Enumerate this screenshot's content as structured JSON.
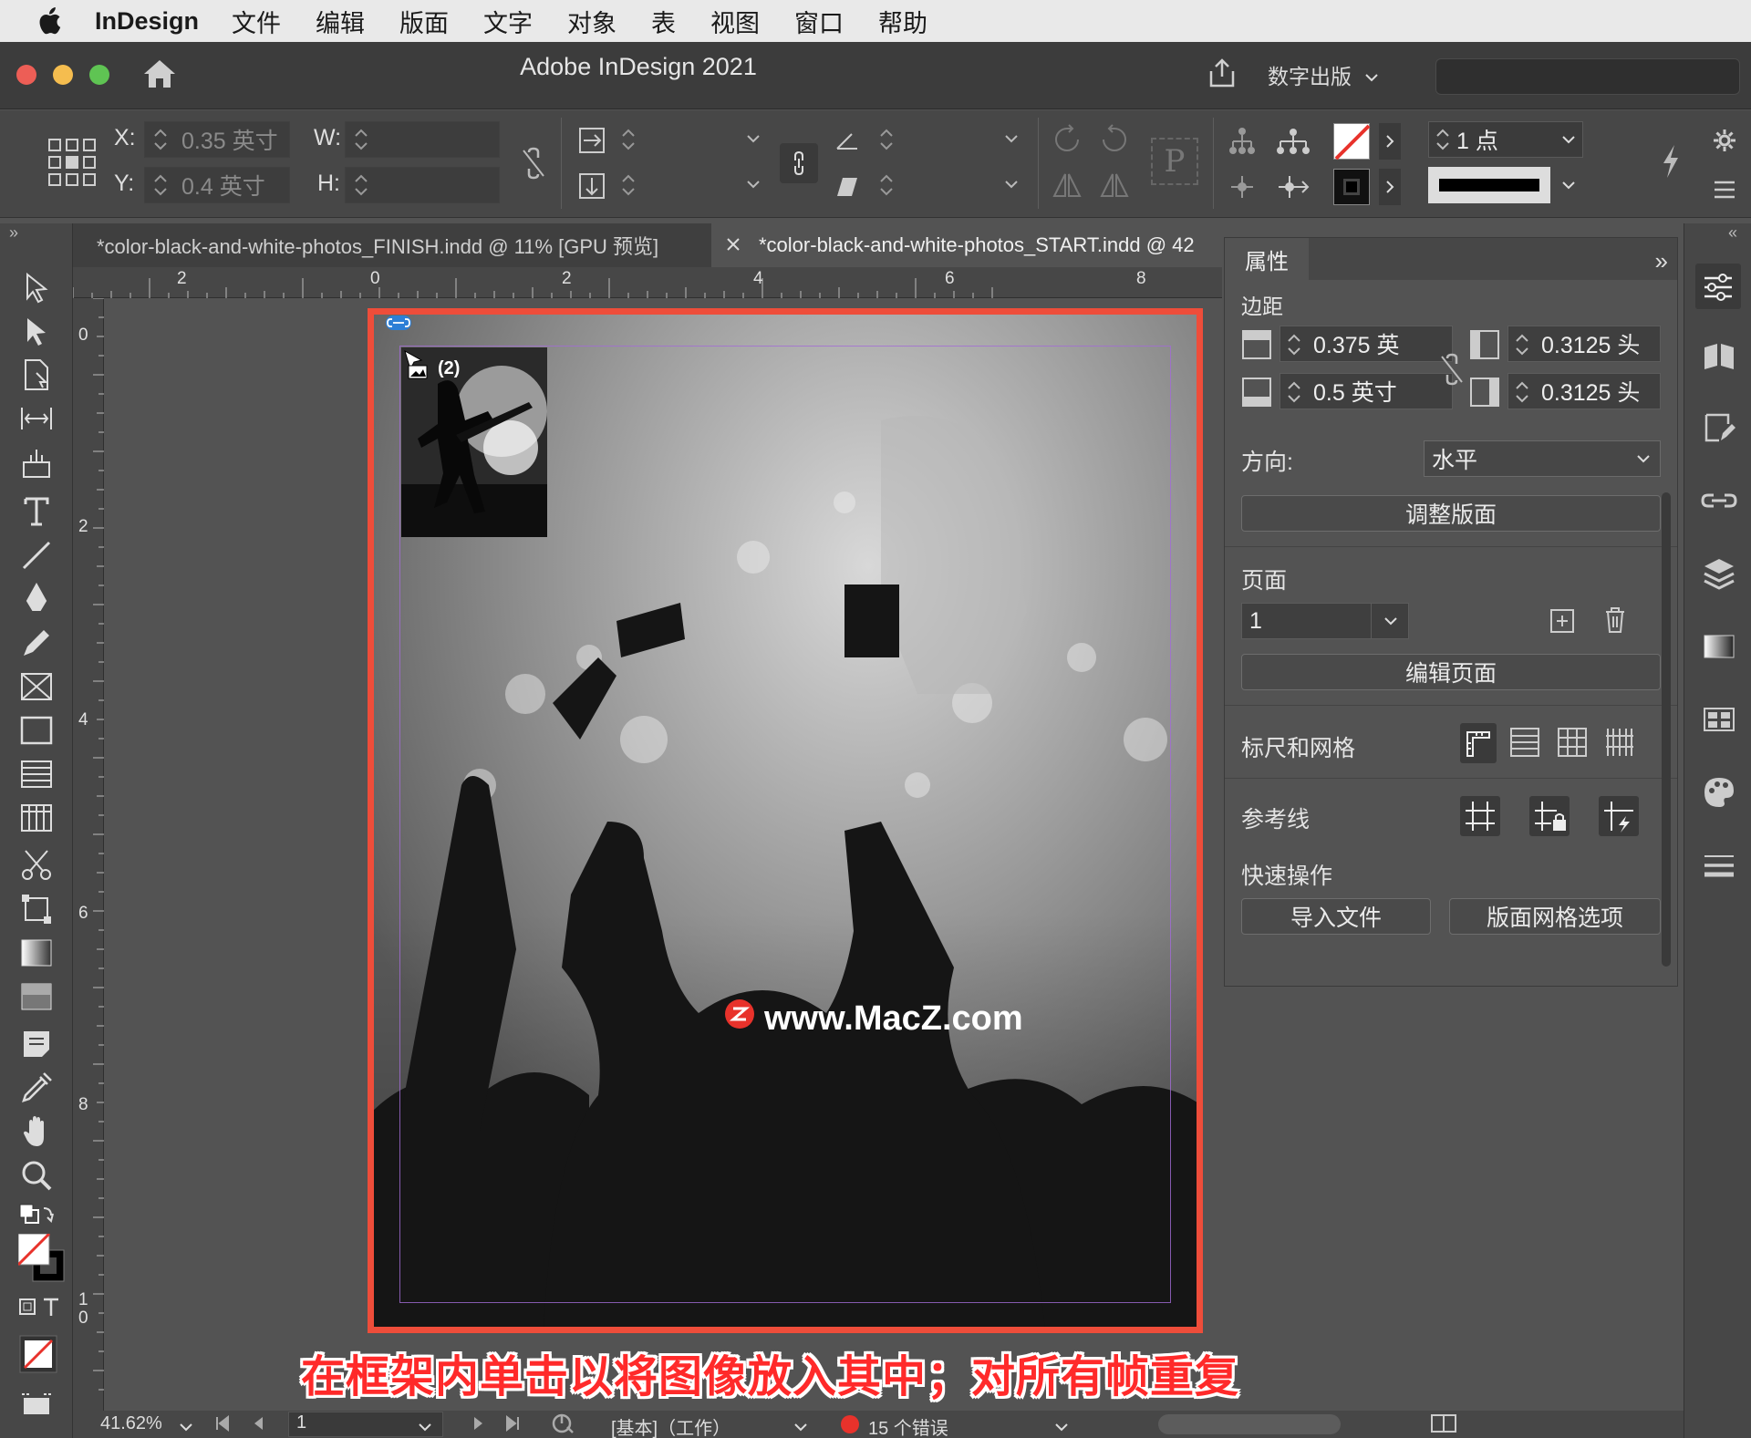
{
  "menubar": {
    "app_name": "InDesign",
    "items": [
      "文件",
      "编辑",
      "版面",
      "文字",
      "对象",
      "表",
      "视图",
      "窗口",
      "帮助"
    ]
  },
  "titlebar": {
    "title": "Adobe InDesign 2021",
    "workspace": "数字出版"
  },
  "control": {
    "x_label": "X:",
    "x_value": "0.35 英寸",
    "y_label": "Y:",
    "y_value": "0.4 英寸",
    "w_label": "W:",
    "h_label": "H:",
    "stroke_weight": "1 点"
  },
  "tabs": [
    {
      "label": "*color-black-and-white-photos_FINISH.indd @ 11% [GPU 预览]"
    },
    {
      "label": "*color-black-and-white-photos_START.indd @ 42"
    }
  ],
  "ruler": {
    "h": [
      "2",
      "0",
      "2",
      "4",
      "6",
      "8"
    ],
    "v": [
      "0",
      "2",
      "4",
      "6",
      "8",
      "1",
      "0"
    ]
  },
  "placed_count": "(2)",
  "watermark": "www.MacZ.com",
  "caption": "在框架内单击以将图像放入其中；对所有帧重复",
  "properties": {
    "tab": "属性",
    "margins_title": "边距",
    "top_margin": "0.375 英",
    "bottom_margin": "0.5 英寸",
    "inside_margin": "0.3125 头",
    "outside_margin": "0.3125 头",
    "orientation_label": "方向:",
    "orientation_value": "水平",
    "adjust_layout": "调整版面",
    "page_title": "页面",
    "page_value": "1",
    "edit_page": "编辑页面",
    "rulers_grids": "标尺和网格",
    "guides": "参考线",
    "quick_actions": "快速操作",
    "import_file": "导入文件",
    "layout_grid_options": "版面网格选项"
  },
  "status": {
    "zoom": "41.62%",
    "page": "1",
    "preflight_profile": "[基本]（工作）",
    "errors": "15 个错误"
  },
  "colors": {
    "selection_frame": "#ee4d3a",
    "caption_red": "#ff2a2a",
    "error_dot": "#e8322b"
  }
}
